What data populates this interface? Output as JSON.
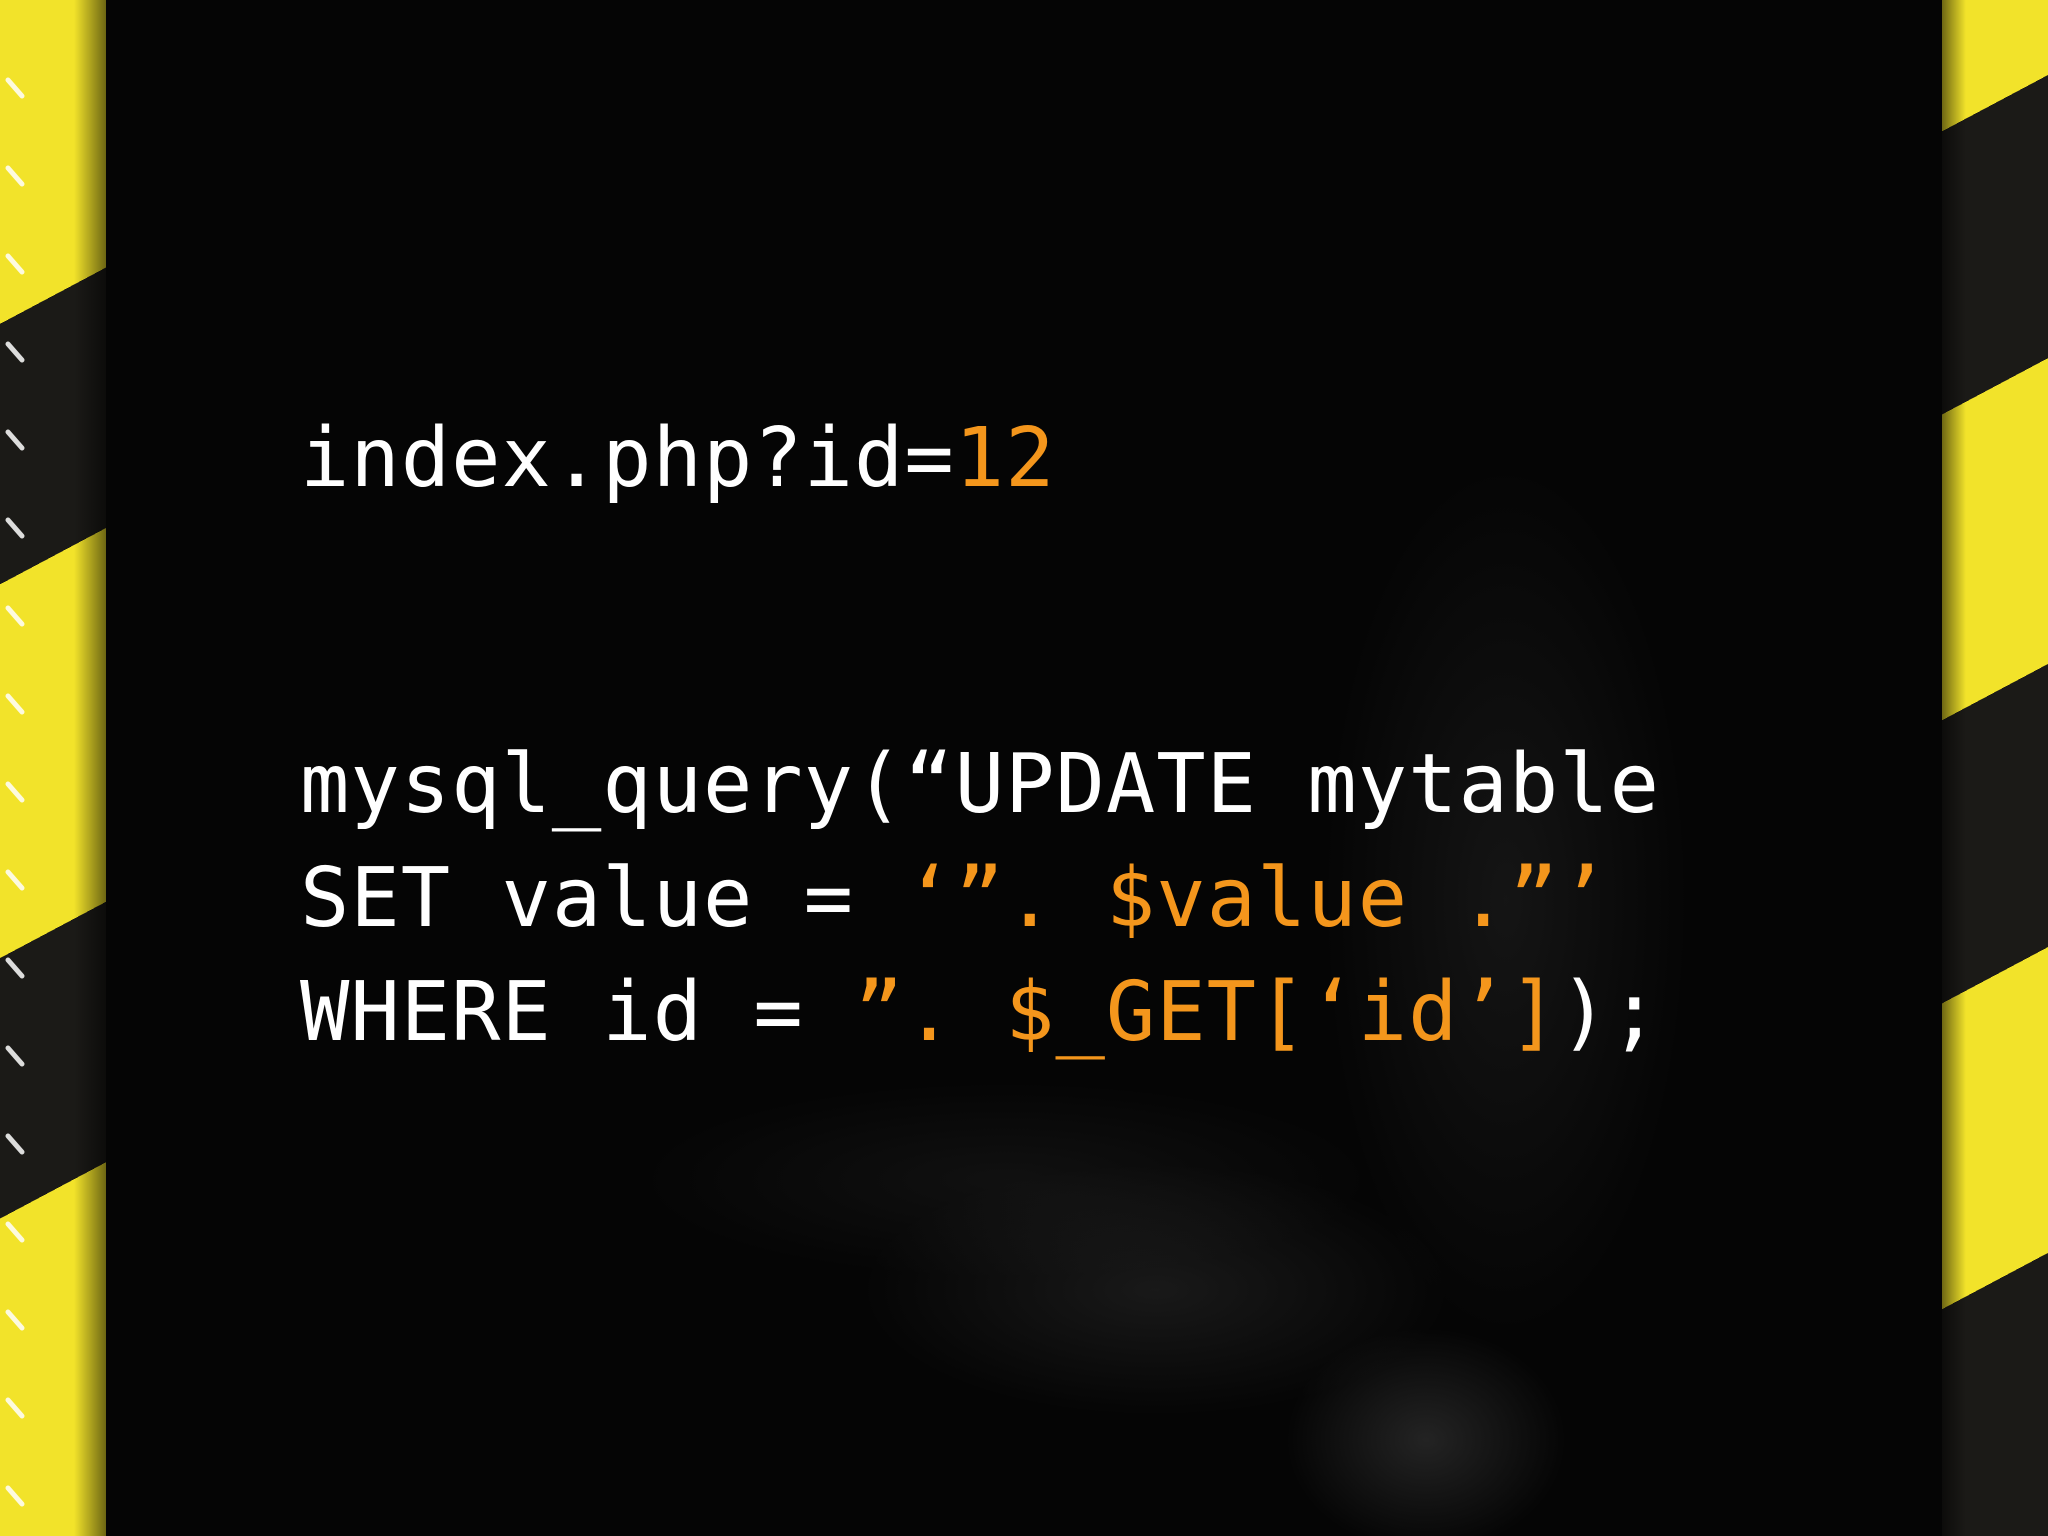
{
  "colors": {
    "background": "#050505",
    "text": "#ffffff",
    "highlight": "#f4961c",
    "stripe_yellow": "#f2e32a",
    "stripe_dark": "#1b1a17"
  },
  "url_line": {
    "prefix": "index.php?id=",
    "value": "12"
  },
  "query": {
    "line1": "mysql_query(“UPDATE mytable",
    "line2_plain": "SET value = ",
    "line2_highlight": "‘”. $value .”’",
    "line3_plain": "WHERE id = ",
    "line3_highlight": "”. $_GET[‘id’]",
    "line3_tail": ");"
  }
}
